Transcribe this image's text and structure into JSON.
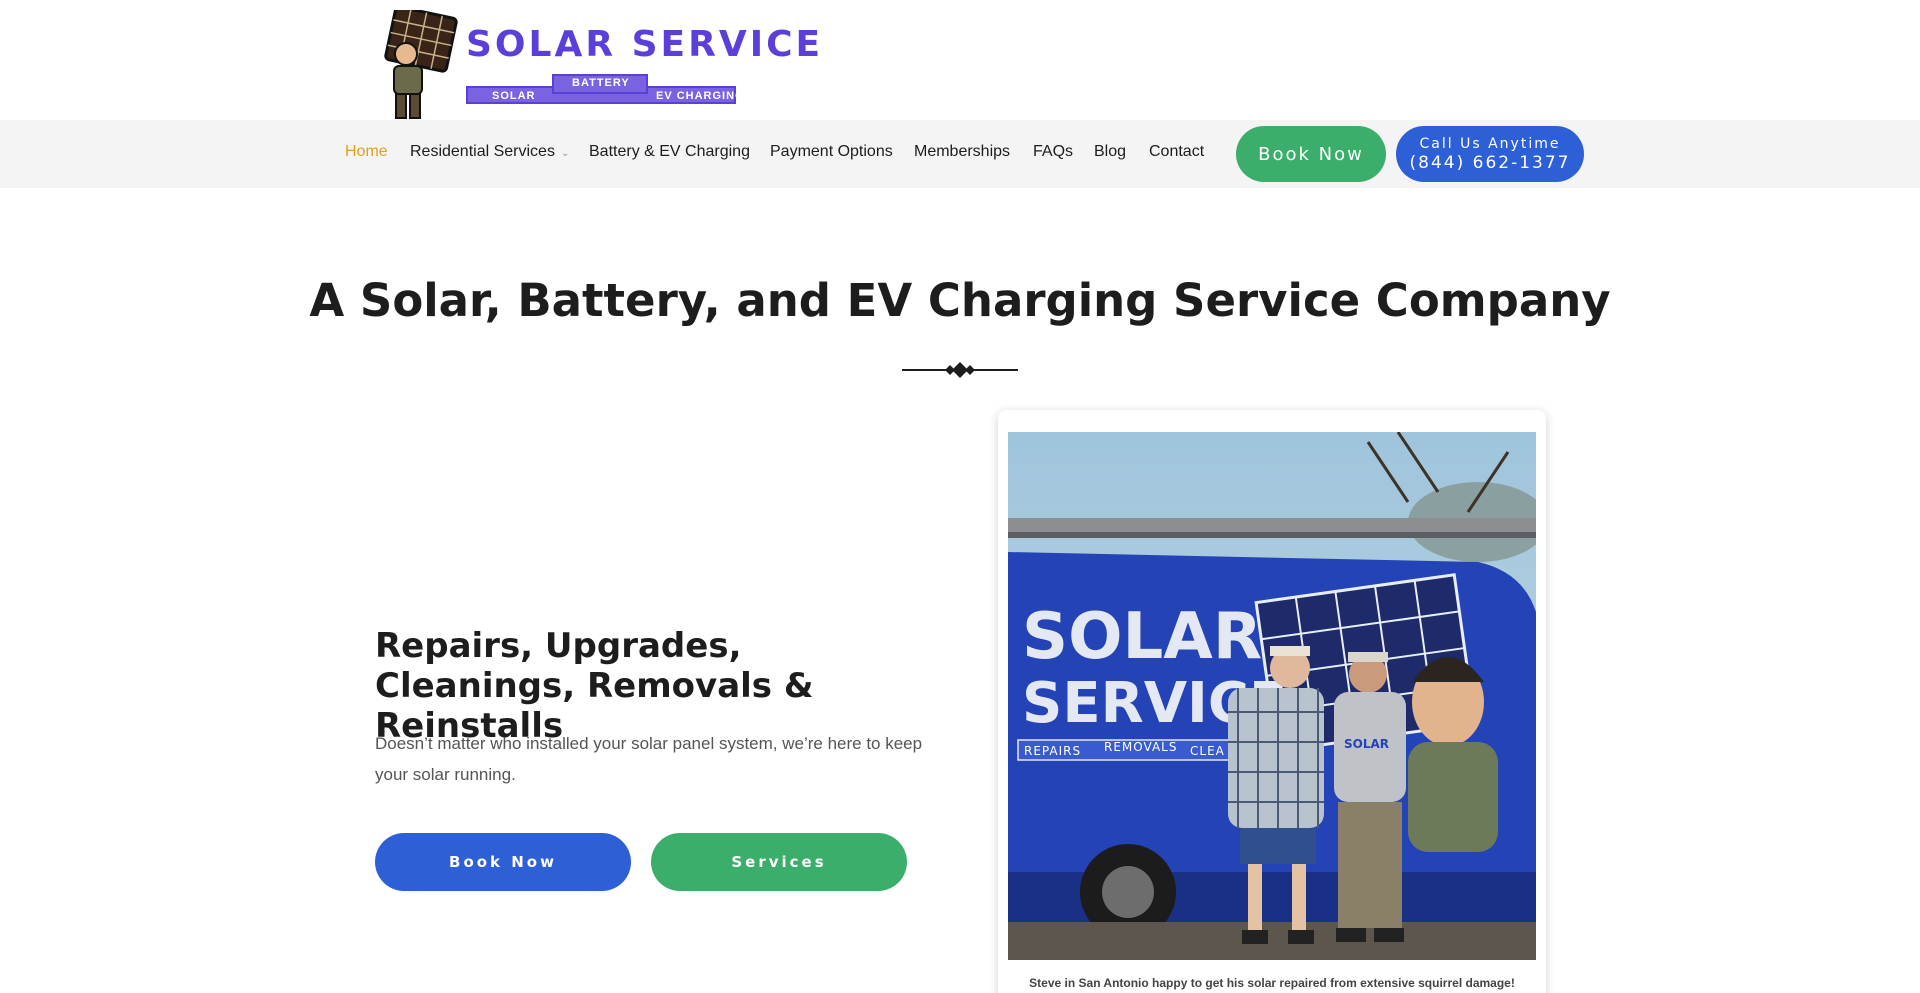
{
  "logo": {
    "title": "SOLAR SERVICE",
    "ribbon": [
      "SOLAR",
      "BATTERY",
      "EV CHARGING"
    ]
  },
  "nav": {
    "items": [
      {
        "label": "Home",
        "active": true
      },
      {
        "label": "Residential Services",
        "has_dropdown": true
      },
      {
        "label": "Battery & EV Charging"
      },
      {
        "label": "Payment Options"
      },
      {
        "label": "Memberships"
      },
      {
        "label": "FAQs"
      },
      {
        "label": "Blog"
      },
      {
        "label": "Contact"
      }
    ],
    "book_label": "Book Now",
    "call_label": "Call Us Anytime",
    "call_phone": "(844) 662-1377"
  },
  "hero": {
    "title": "A Solar, Battery, and EV Charging Service Company",
    "subheading": "Repairs, Upgrades, Cleanings, Removals & Reinstalls",
    "text": "Doesn’t matter who installed your solar panel system, we’re here to keep your solar running.",
    "book_label": "Book Now",
    "services_label": "Services"
  },
  "photo": {
    "van_text_1": "SOLAR",
    "van_text_2": "SERVICE",
    "van_ribbon": [
      "REPAIRS",
      "REMOVALS",
      "CLEA"
    ],
    "caption": "Steve in San Antonio happy to get his solar repaired from extensive squirrel damage!"
  },
  "colors": {
    "accent_orange": "#e3a21a",
    "brand_purple": "#5b3fd8",
    "button_green": "#3aae6a",
    "button_blue": "#2d5fd6"
  }
}
